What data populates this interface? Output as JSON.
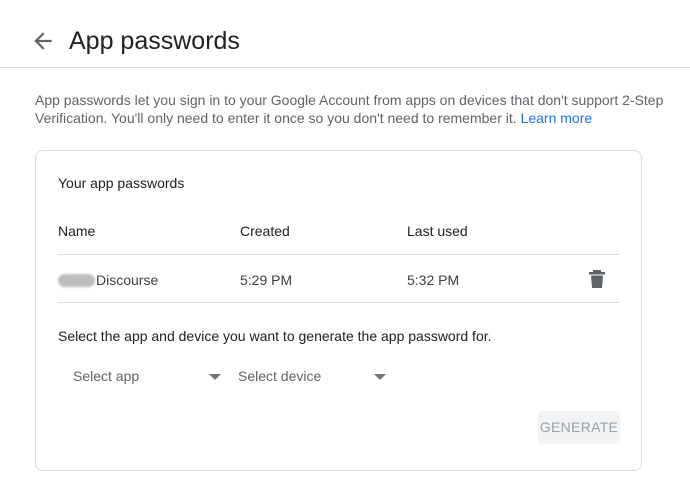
{
  "header": {
    "title": "App passwords",
    "back_icon": "arrow-back-icon"
  },
  "intro": {
    "text": "App passwords let you sign in to your Google Account from apps on devices that don't support 2-Step Verification. You'll only need to enter it once so you don't need to remember it.",
    "link_label": "Learn more"
  },
  "card": {
    "title": "Your app passwords",
    "columns": {
      "name": "Name",
      "created": "Created",
      "last_used": "Last used"
    },
    "rows": [
      {
        "name": "Discourse",
        "created": "5:29 PM",
        "last_used": "5:32 PM",
        "delete_icon": "trash-icon"
      }
    ],
    "select_prompt": "Select the app and device you want to generate the app password for.",
    "select_app": "Select app",
    "select_device": "Select device",
    "generate_label": "GENERATE"
  },
  "colors": {
    "link": "#1a73e8",
    "divider": "#dadce0",
    "button_disabled_bg": "#f1f3f4",
    "button_disabled_text": "#9aa0a6"
  }
}
